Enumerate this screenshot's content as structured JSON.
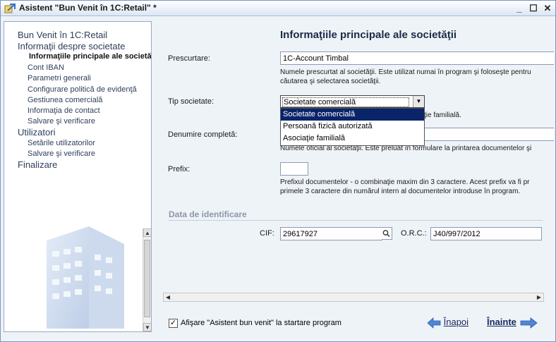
{
  "window": {
    "title": "Asistent \"Bun Venit în 1C:Retail\" *",
    "min": "_",
    "max": "☐",
    "close": "✕"
  },
  "nav": {
    "items": [
      {
        "label": "Bun Venit în 1C:Retail",
        "level": 0,
        "active": false
      },
      {
        "label": "Informaţii despre societate",
        "level": 0,
        "active": false
      },
      {
        "label": "Informaţiile principale ale societăţii",
        "level": 1,
        "active": true
      },
      {
        "label": "Cont IBAN",
        "level": 1,
        "active": false
      },
      {
        "label": "Parametri generali",
        "level": 1,
        "active": false
      },
      {
        "label": "Configurare politică de evidenţă",
        "level": 1,
        "active": false
      },
      {
        "label": "Gestiunea comercială",
        "level": 1,
        "active": false
      },
      {
        "label": "Informaţia de contact",
        "level": 1,
        "active": false
      },
      {
        "label": "Salvare şi verificare",
        "level": 1,
        "active": false
      },
      {
        "label": "Utilizatori",
        "level": 0,
        "active": false
      },
      {
        "label": "Setările utilizatorilor",
        "level": 1,
        "active": false
      },
      {
        "label": "Salvare şi verificare",
        "level": 1,
        "active": false
      },
      {
        "label": "Finalizare",
        "level": 0,
        "active": false
      }
    ]
  },
  "main": {
    "title": "Informaţiile principale ale societăţii",
    "prescurtare": {
      "label": "Prescurtare:",
      "value": "1C-Account Timbal",
      "hint_1": "Numele prescurtat al societăţii. Este utilizat numai în program şi foloseşte pentru",
      "hint_2": "căutarea şi selectarea societăţii."
    },
    "tip_societate": {
      "label": "Tip societate:",
      "value": "Societate comercială",
      "options": [
        "Societate comercială",
        "Persoană fizică autorizată",
        "Asociaţie familială"
      ],
      "hint_tail": "ţie familială."
    },
    "denumire": {
      "label": "Denumire completă:",
      "hint": "Numele oficial al societăţii. Este preluat în formulare la printarea documentelor şi"
    },
    "prefix": {
      "label": "Prefix:",
      "value": "",
      "hint_1": "Prefixul documentelor - o combinaţie maxim din 3 caractere. Acest prefix va fi pr",
      "hint_2": "primele 3 caractere din numărul intern al documentelor introduse în program."
    },
    "identificare": {
      "section_title": "Data de identificare",
      "cif_label": "CIF:",
      "cif_value": "29617927",
      "orc_label": "O.R.C.:",
      "orc_value": "J40/997/2012"
    }
  },
  "footer": {
    "checkbox_label": "Afişare \"Asistent bun venit\" la startare program",
    "checked": true,
    "back_label": "Înapoi",
    "next_label": "Înainte"
  },
  "colors": {
    "selection": "#0a246a",
    "link": "#1b2a60",
    "accent_arrow": "#4f86d6"
  }
}
